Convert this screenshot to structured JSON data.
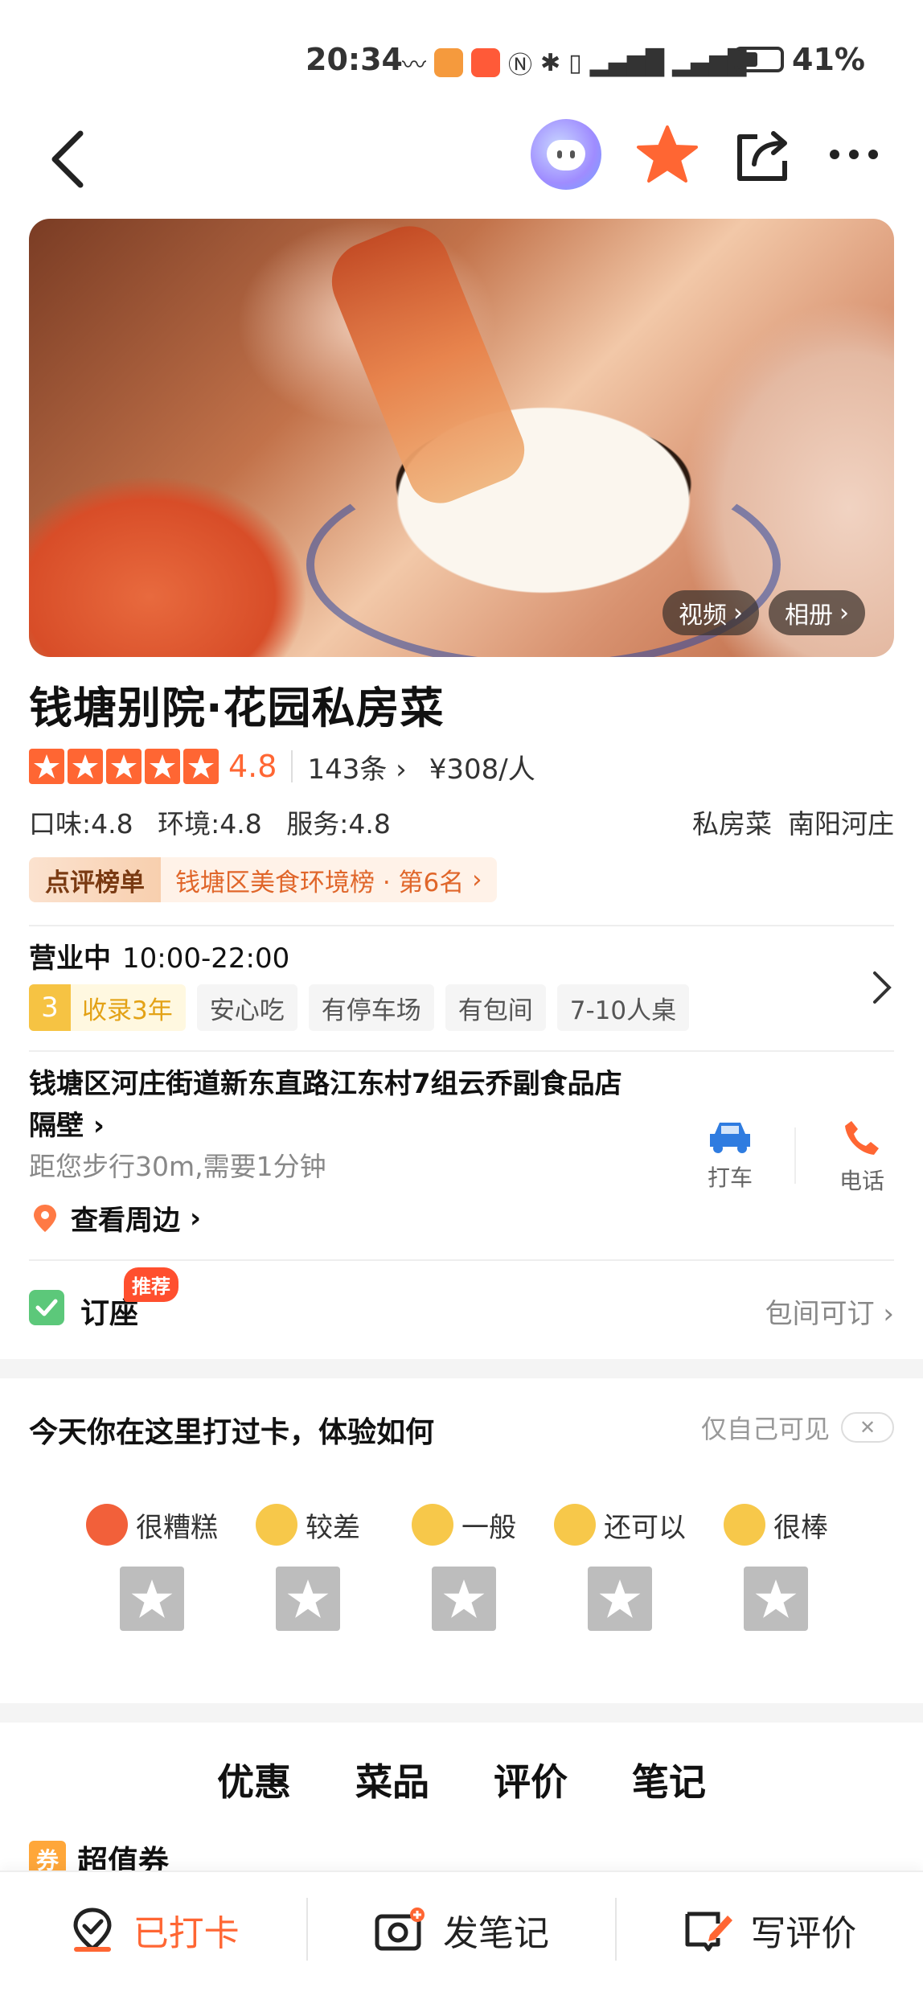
{
  "status_bar": {
    "time": "20:34",
    "battery": "41%",
    "battery_level": 0.41
  },
  "nav": {
    "back_icon": "back-chevron-icon",
    "ai_icon": "ai-assistant-icon",
    "favorite_icon": "star-icon",
    "share_icon": "share-icon",
    "more_icon": "more-icon"
  },
  "hero": {
    "video_label": "视频",
    "album_label": "相册"
  },
  "shop": {
    "name": "钱塘别院·花园私房菜",
    "rating": "4.8",
    "stars": 5,
    "review_count": "143条",
    "price": "¥308/人",
    "taste": "口味:4.8",
    "environment": "环境:4.8",
    "service": "服务:4.8",
    "category": "私房菜",
    "area": "南阳河庄"
  },
  "rank": {
    "tag": "点评榜单",
    "text": "钱塘区美食环境榜 · 第6名"
  },
  "hours": {
    "status": "营业中",
    "time": "10:00-22:00"
  },
  "chips": {
    "year_num": "3",
    "year_text": "收录3年",
    "items": [
      "安心吃",
      "有停车场",
      "有包间",
      "7-10人桌"
    ]
  },
  "address": {
    "line1": "钱塘区河庄街道新东直路江东村7组云乔副食品店",
    "line2": "隔壁",
    "distance": "距您步行30m,需要1分钟",
    "nearby": "查看周边",
    "taxi": "打车",
    "call": "电话"
  },
  "booking": {
    "label": "订座",
    "badge": "推荐",
    "right": "包间可订"
  },
  "checkin": {
    "title": "今天你在这里打过卡，体验如何",
    "visibility": "仅自己可见",
    "close": "✕",
    "moods": [
      {
        "label": "很糟糕",
        "color": "#f2603a"
      },
      {
        "label": "较差",
        "color": "#f7c84a"
      },
      {
        "label": "一般",
        "color": "#f7c84a"
      },
      {
        "label": "还可以",
        "color": "#f7c84a"
      },
      {
        "label": "很棒",
        "color": "#f7c84a"
      }
    ]
  },
  "tabs": [
    {
      "label": "优惠",
      "active": true
    },
    {
      "label": "菜品",
      "active": false
    },
    {
      "label": "评价",
      "active": false
    },
    {
      "label": "笔记",
      "active": false
    }
  ],
  "coupon": {
    "icon_text": "券",
    "title": "超值券"
  },
  "bottom_bar": {
    "checked_in": "已打卡",
    "post_note": "发笔记",
    "write_review": "写评价"
  },
  "colors": {
    "accent": "#ff6633",
    "taxi": "#2f7ce0",
    "call": "#ff6633"
  }
}
